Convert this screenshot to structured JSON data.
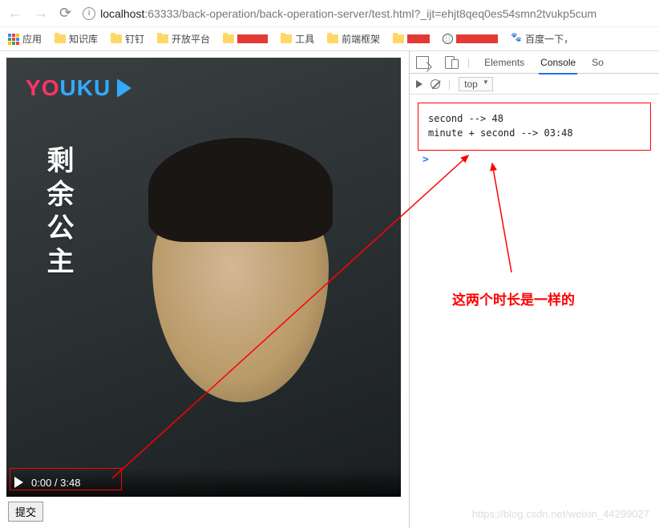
{
  "nav": {
    "url_host": "localhost",
    "url_port": ":63333",
    "url_path": "/back-operation/back-operation-server/test.html?_ijt=ehjt8qeq0es54smn2tvukp5cum"
  },
  "bookmarks": {
    "apps": "应用",
    "items": [
      "知识库",
      "钉钉",
      "开放平台",
      "",
      "工具",
      "前端框架",
      "",
      "",
      "百度一下，"
    ]
  },
  "video": {
    "logo_text": "YOUKU",
    "title": "剩余公主",
    "time_current": "0:00",
    "time_total": "3:48"
  },
  "submit_label": "提交",
  "devtools": {
    "tabs": [
      "Elements",
      "Console",
      "So"
    ],
    "context": "top",
    "console_lines": [
      "second --> 48",
      "minute + second --> 03:48"
    ],
    "prompt": ">"
  },
  "annotation": "这两个时长是一样的",
  "watermark": "https://blog.csdn.net/weixin_44299027"
}
